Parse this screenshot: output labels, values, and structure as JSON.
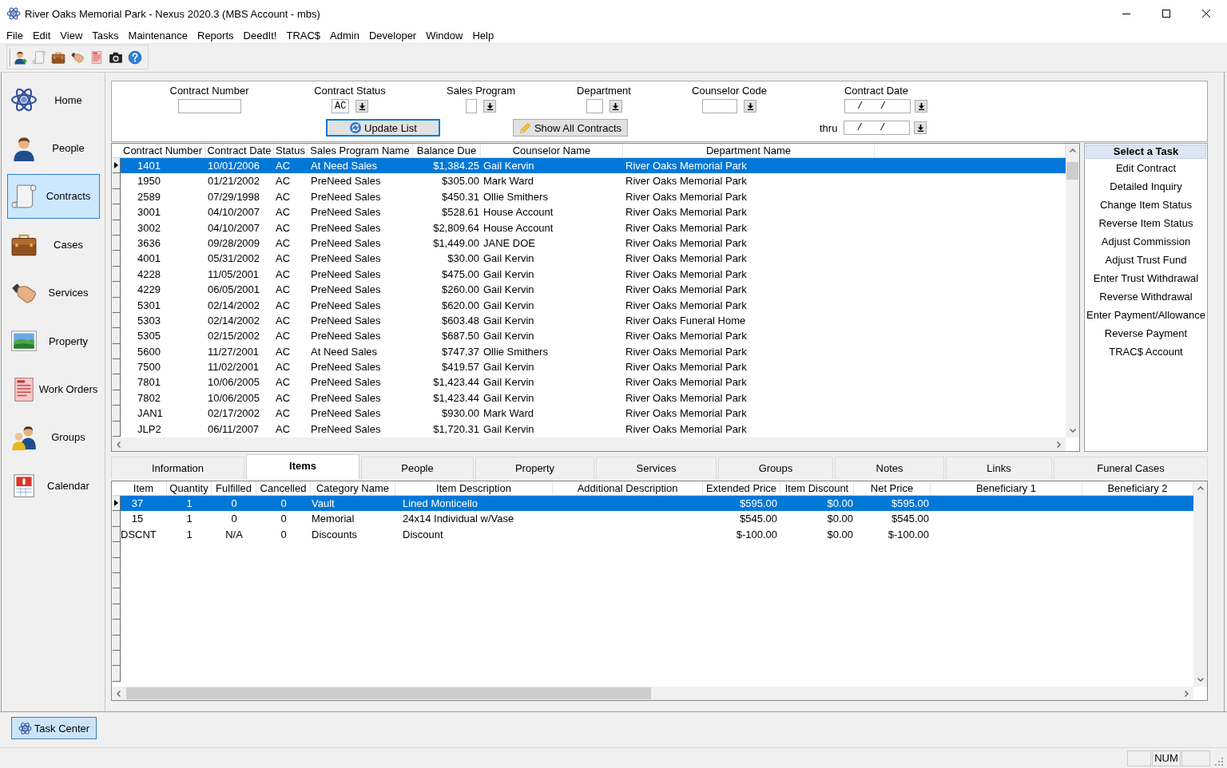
{
  "window": {
    "title": "River Oaks Memorial Park - Nexus 2020.3 (MBS Account - mbs)"
  },
  "menu": [
    "File",
    "Edit",
    "View",
    "Tasks",
    "Maintenance",
    "Reports",
    "DeedIt!",
    "TRAC$",
    "Admin",
    "Developer",
    "Window",
    "Help"
  ],
  "sidebar": {
    "items": [
      {
        "label": "Home",
        "kind": "atom",
        "selected": false
      },
      {
        "label": "People",
        "kind": "person",
        "selected": false
      },
      {
        "label": "Contracts",
        "kind": "scroll",
        "selected": true
      },
      {
        "label": "Cases",
        "kind": "briefcase",
        "selected": false
      },
      {
        "label": "Services",
        "kind": "handshake",
        "selected": false
      },
      {
        "label": "Property",
        "kind": "landscape",
        "selected": false
      },
      {
        "label": "Work Orders",
        "kind": "form",
        "selected": false
      },
      {
        "label": "Groups",
        "kind": "group",
        "selected": false
      },
      {
        "label": "Calendar",
        "kind": "calendar",
        "selected": false
      }
    ]
  },
  "filters": {
    "fields": [
      {
        "label": "Contract Number",
        "kind": "text"
      },
      {
        "label": "Contract Status",
        "kind": "combo",
        "value": "AC"
      },
      {
        "label": "Sales Program",
        "kind": "combo"
      },
      {
        "label": "Department",
        "kind": "combo"
      },
      {
        "label": "Counselor Code",
        "kind": "combo"
      },
      {
        "label": "Contract Date",
        "kind": "date",
        "value": "/   /"
      }
    ],
    "buttons": [
      {
        "label": "Update List",
        "kind": "refresh",
        "focused": true
      },
      {
        "label": "Show All Contracts",
        "kind": "pencil",
        "focused": false
      }
    ],
    "thru": {
      "label": "thru",
      "value": "/   /"
    }
  },
  "contracts": {
    "columns": [
      "Contract Number",
      "Contract Date",
      "Status",
      "Sales Program Name",
      "Balance Due",
      "Counselor Name",
      "Department Name"
    ],
    "rows": [
      {
        "selected": true,
        "cells": [
          "1401",
          "10/01/2006",
          "AC",
          "At Need Sales",
          "$1,384.25",
          "Gail Kervin",
          "River Oaks Memorial Park"
        ]
      },
      {
        "selected": false,
        "cells": [
          "1950",
          "01/21/2002",
          "AC",
          "PreNeed Sales",
          "$305.00",
          "Mark Ward",
          "River Oaks Memorial Park"
        ]
      },
      {
        "selected": false,
        "cells": [
          "2589",
          "07/29/1998",
          "AC",
          "PreNeed Sales",
          "$450.31",
          "Ollie Smithers",
          "River Oaks Memorial Park"
        ]
      },
      {
        "selected": false,
        "cells": [
          "3001",
          "04/10/2007",
          "AC",
          "PreNeed Sales",
          "$528.61",
          "House Account",
          "River Oaks Memorial Park"
        ]
      },
      {
        "selected": false,
        "cells": [
          "3002",
          "04/10/2007",
          "AC",
          "PreNeed Sales",
          "$2,809.64",
          "House Account",
          "River Oaks Memorial Park"
        ]
      },
      {
        "selected": false,
        "cells": [
          "3636",
          "09/28/2009",
          "AC",
          "PreNeed Sales",
          "$1,449.00",
          "JANE DOE",
          "River Oaks Memorial Park"
        ]
      },
      {
        "selected": false,
        "cells": [
          "4001",
          "05/31/2002",
          "AC",
          "PreNeed Sales",
          "$30.00",
          "Gail Kervin",
          "River Oaks Memorial Park"
        ]
      },
      {
        "selected": false,
        "cells": [
          "4228",
          "11/05/2001",
          "AC",
          "PreNeed Sales",
          "$475.00",
          "Gail Kervin",
          "River Oaks Memorial Park"
        ]
      },
      {
        "selected": false,
        "cells": [
          "4229",
          "06/05/2001",
          "AC",
          "PreNeed Sales",
          "$260.00",
          "Gail Kervin",
          "River Oaks Memorial Park"
        ]
      },
      {
        "selected": false,
        "cells": [
          "5301",
          "02/14/2002",
          "AC",
          "PreNeed Sales",
          "$620.00",
          "Gail Kervin",
          "River Oaks Memorial Park"
        ]
      },
      {
        "selected": false,
        "cells": [
          "5303",
          "02/14/2002",
          "AC",
          "PreNeed Sales",
          "$603.48",
          "Gail Kervin",
          "River Oaks Funeral Home"
        ]
      },
      {
        "selected": false,
        "cells": [
          "5305",
          "02/15/2002",
          "AC",
          "PreNeed Sales",
          "$687.50",
          "Gail Kervin",
          "River Oaks Memorial Park"
        ]
      },
      {
        "selected": false,
        "cells": [
          "5600",
          "11/27/2001",
          "AC",
          "At Need Sales",
          "$747.37",
          "Ollie Smithers",
          "River Oaks Memorial Park"
        ]
      },
      {
        "selected": false,
        "cells": [
          "7500",
          "11/02/2001",
          "AC",
          "PreNeed Sales",
          "$419.57",
          "Gail Kervin",
          "River Oaks Memorial Park"
        ]
      },
      {
        "selected": false,
        "cells": [
          "7801",
          "10/06/2005",
          "AC",
          "PreNeed Sales",
          "$1,423.44",
          "Gail Kervin",
          "River Oaks Memorial Park"
        ]
      },
      {
        "selected": false,
        "cells": [
          "7802",
          "10/06/2005",
          "AC",
          "PreNeed Sales",
          "$1,423.44",
          "Gail Kervin",
          "River Oaks Memorial Park"
        ]
      },
      {
        "selected": false,
        "cells": [
          "JAN1",
          "02/17/2002",
          "AC",
          "PreNeed Sales",
          "$930.00",
          "Mark Ward",
          "River Oaks Memorial Park"
        ]
      },
      {
        "selected": false,
        "cells": [
          "JLP2",
          "06/11/2007",
          "AC",
          "PreNeed Sales",
          "$1,720.31",
          "Gail Kervin",
          "River Oaks Memorial Park"
        ]
      }
    ]
  },
  "tasks": {
    "title": "Select a Task",
    "items": [
      "Edit Contract",
      "Detailed Inquiry",
      "Change Item Status",
      "Reverse Item Status",
      "Adjust Commission",
      "Adjust Trust Fund",
      "Enter Trust Withdrawal",
      "Reverse Withdrawal",
      "Enter Payment/Allowance",
      "Reverse Payment",
      "TRAC$ Account"
    ]
  },
  "tabs": [
    {
      "label": "Information",
      "selected": false
    },
    {
      "label": "Items",
      "selected": true
    },
    {
      "label": "People",
      "selected": false
    },
    {
      "label": "Property",
      "selected": false
    },
    {
      "label": "Services",
      "selected": false
    },
    {
      "label": "Groups",
      "selected": false
    },
    {
      "label": "Notes",
      "selected": false
    },
    {
      "label": "Links",
      "selected": false
    },
    {
      "label": "Funeral Cases",
      "selected": false
    }
  ],
  "items": {
    "columns": [
      "Item",
      "Quantity",
      "Fulfilled",
      "Cancelled",
      "Category Name",
      "Item Description",
      "Additional Description",
      "Extended Price",
      "Item Discount",
      "Net Price",
      "Beneficiary 1",
      "Beneficiary 2"
    ],
    "rows": [
      {
        "selected": true,
        "cells": [
          "37",
          "1",
          "0",
          "0",
          "Vault",
          "Lined Monticello",
          null,
          "$595.00",
          "$0.00",
          "$595.00"
        ]
      },
      {
        "selected": false,
        "cells": [
          "15",
          "1",
          "0",
          "0",
          "Memorial",
          "24x14 Individual w/Vase",
          null,
          "$545.00",
          "$0.00",
          "$545.00"
        ]
      },
      {
        "selected": false,
        "cells": [
          "DSCNT",
          "1",
          "N/A",
          "0",
          "Discounts",
          "Discount",
          null,
          "$-100.00",
          "$0.00",
          "$-100.00"
        ]
      }
    ]
  },
  "task_center": {
    "label": "Task Center"
  },
  "status_bar": {
    "keyboard_indicator": "NUM"
  }
}
